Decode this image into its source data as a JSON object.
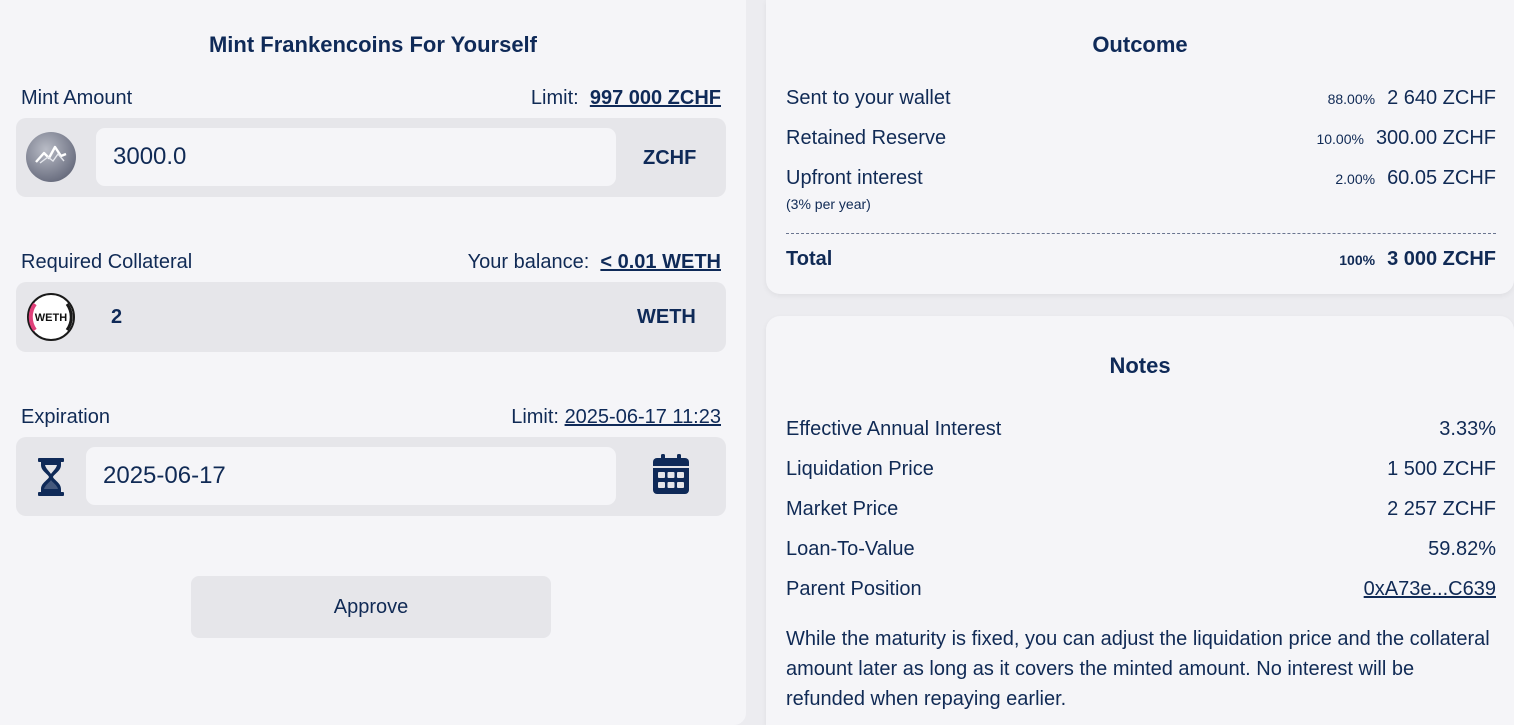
{
  "mint": {
    "title": "Mint Frankencoins For Yourself",
    "amount_label": "Mint Amount",
    "limit_prefix": "Limit:",
    "limit_value": "997 000 ZCHF",
    "amount_value": "3000.0",
    "amount_unit": "ZCHF",
    "collateral_label": "Required Collateral",
    "balance_prefix": "Your balance:",
    "balance_value": "< 0.01 WETH",
    "collateral_value": "2",
    "collateral_unit": "WETH",
    "weth_logo_text": "WETH",
    "expiration_label": "Expiration",
    "expiration_limit_prefix": "Limit:",
    "expiration_limit_value": "2025-06-17 11:23",
    "expiration_value": "2025-06-17",
    "approve_label": "Approve"
  },
  "outcome": {
    "title": "Outcome",
    "rows": [
      {
        "label": "Sent to your wallet",
        "pct": "88.00%",
        "value": "2 640 ZCHF"
      },
      {
        "label": "Retained Reserve",
        "pct": "10.00%",
        "value": "300.00 ZCHF"
      },
      {
        "label": "Upfront interest",
        "pct": "2.00%",
        "value": "60.05 ZCHF",
        "note": "(3% per year)"
      }
    ],
    "total": {
      "label": "Total",
      "pct": "100%",
      "value": "3 000 ZCHF"
    }
  },
  "notes": {
    "title": "Notes",
    "rows": [
      {
        "label": "Effective Annual Interest",
        "value": "3.33%"
      },
      {
        "label": "Liquidation Price",
        "value": "1 500 ZCHF"
      },
      {
        "label": "Market Price",
        "value": "2 257 ZCHF"
      },
      {
        "label": "Loan-To-Value",
        "value": "59.82%"
      },
      {
        "label": "Parent Position",
        "value": "0xA73e...C639"
      }
    ],
    "paragraph": "While the maturity is fixed, you can adjust the liquidation price and the collateral amount later as long as it covers the minted amount. No interest will be refunded when repaying earlier."
  },
  "icons": {
    "zchf_coin": "frankencoin-logo-icon",
    "weth_coin": "weth-logo-icon",
    "hourglass": "hourglass-icon",
    "calendar": "calendar-icon"
  },
  "colors": {
    "text": "#102a55",
    "panel": "#f5f5f8",
    "box": "#e6e6ea",
    "weth_accent": "#e0407a"
  }
}
